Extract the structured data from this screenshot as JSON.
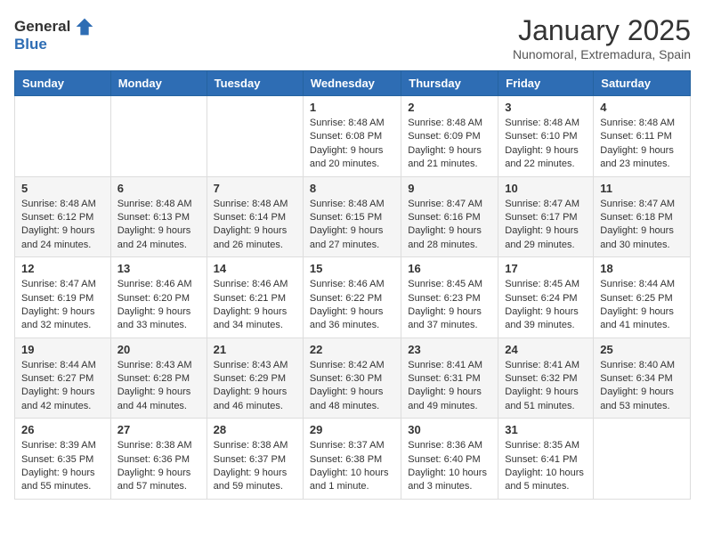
{
  "header": {
    "logo_general": "General",
    "logo_blue": "Blue",
    "title": "January 2025",
    "subtitle": "Nunomoral, Extremadura, Spain"
  },
  "weekdays": [
    "Sunday",
    "Monday",
    "Tuesday",
    "Wednesday",
    "Thursday",
    "Friday",
    "Saturday"
  ],
  "weeks": [
    [
      {
        "day": "",
        "sunrise": "",
        "sunset": "",
        "daylight": ""
      },
      {
        "day": "",
        "sunrise": "",
        "sunset": "",
        "daylight": ""
      },
      {
        "day": "",
        "sunrise": "",
        "sunset": "",
        "daylight": ""
      },
      {
        "day": "1",
        "sunrise": "Sunrise: 8:48 AM",
        "sunset": "Sunset: 6:08 PM",
        "daylight": "Daylight: 9 hours and 20 minutes."
      },
      {
        "day": "2",
        "sunrise": "Sunrise: 8:48 AM",
        "sunset": "Sunset: 6:09 PM",
        "daylight": "Daylight: 9 hours and 21 minutes."
      },
      {
        "day": "3",
        "sunrise": "Sunrise: 8:48 AM",
        "sunset": "Sunset: 6:10 PM",
        "daylight": "Daylight: 9 hours and 22 minutes."
      },
      {
        "day": "4",
        "sunrise": "Sunrise: 8:48 AM",
        "sunset": "Sunset: 6:11 PM",
        "daylight": "Daylight: 9 hours and 23 minutes."
      }
    ],
    [
      {
        "day": "5",
        "sunrise": "Sunrise: 8:48 AM",
        "sunset": "Sunset: 6:12 PM",
        "daylight": "Daylight: 9 hours and 24 minutes."
      },
      {
        "day": "6",
        "sunrise": "Sunrise: 8:48 AM",
        "sunset": "Sunset: 6:13 PM",
        "daylight": "Daylight: 9 hours and 24 minutes."
      },
      {
        "day": "7",
        "sunrise": "Sunrise: 8:48 AM",
        "sunset": "Sunset: 6:14 PM",
        "daylight": "Daylight: 9 hours and 26 minutes."
      },
      {
        "day": "8",
        "sunrise": "Sunrise: 8:48 AM",
        "sunset": "Sunset: 6:15 PM",
        "daylight": "Daylight: 9 hours and 27 minutes."
      },
      {
        "day": "9",
        "sunrise": "Sunrise: 8:47 AM",
        "sunset": "Sunset: 6:16 PM",
        "daylight": "Daylight: 9 hours and 28 minutes."
      },
      {
        "day": "10",
        "sunrise": "Sunrise: 8:47 AM",
        "sunset": "Sunset: 6:17 PM",
        "daylight": "Daylight: 9 hours and 29 minutes."
      },
      {
        "day": "11",
        "sunrise": "Sunrise: 8:47 AM",
        "sunset": "Sunset: 6:18 PM",
        "daylight": "Daylight: 9 hours and 30 minutes."
      }
    ],
    [
      {
        "day": "12",
        "sunrise": "Sunrise: 8:47 AM",
        "sunset": "Sunset: 6:19 PM",
        "daylight": "Daylight: 9 hours and 32 minutes."
      },
      {
        "day": "13",
        "sunrise": "Sunrise: 8:46 AM",
        "sunset": "Sunset: 6:20 PM",
        "daylight": "Daylight: 9 hours and 33 minutes."
      },
      {
        "day": "14",
        "sunrise": "Sunrise: 8:46 AM",
        "sunset": "Sunset: 6:21 PM",
        "daylight": "Daylight: 9 hours and 34 minutes."
      },
      {
        "day": "15",
        "sunrise": "Sunrise: 8:46 AM",
        "sunset": "Sunset: 6:22 PM",
        "daylight": "Daylight: 9 hours and 36 minutes."
      },
      {
        "day": "16",
        "sunrise": "Sunrise: 8:45 AM",
        "sunset": "Sunset: 6:23 PM",
        "daylight": "Daylight: 9 hours and 37 minutes."
      },
      {
        "day": "17",
        "sunrise": "Sunrise: 8:45 AM",
        "sunset": "Sunset: 6:24 PM",
        "daylight": "Daylight: 9 hours and 39 minutes."
      },
      {
        "day": "18",
        "sunrise": "Sunrise: 8:44 AM",
        "sunset": "Sunset: 6:25 PM",
        "daylight": "Daylight: 9 hours and 41 minutes."
      }
    ],
    [
      {
        "day": "19",
        "sunrise": "Sunrise: 8:44 AM",
        "sunset": "Sunset: 6:27 PM",
        "daylight": "Daylight: 9 hours and 42 minutes."
      },
      {
        "day": "20",
        "sunrise": "Sunrise: 8:43 AM",
        "sunset": "Sunset: 6:28 PM",
        "daylight": "Daylight: 9 hours and 44 minutes."
      },
      {
        "day": "21",
        "sunrise": "Sunrise: 8:43 AM",
        "sunset": "Sunset: 6:29 PM",
        "daylight": "Daylight: 9 hours and 46 minutes."
      },
      {
        "day": "22",
        "sunrise": "Sunrise: 8:42 AM",
        "sunset": "Sunset: 6:30 PM",
        "daylight": "Daylight: 9 hours and 48 minutes."
      },
      {
        "day": "23",
        "sunrise": "Sunrise: 8:41 AM",
        "sunset": "Sunset: 6:31 PM",
        "daylight": "Daylight: 9 hours and 49 minutes."
      },
      {
        "day": "24",
        "sunrise": "Sunrise: 8:41 AM",
        "sunset": "Sunset: 6:32 PM",
        "daylight": "Daylight: 9 hours and 51 minutes."
      },
      {
        "day": "25",
        "sunrise": "Sunrise: 8:40 AM",
        "sunset": "Sunset: 6:34 PM",
        "daylight": "Daylight: 9 hours and 53 minutes."
      }
    ],
    [
      {
        "day": "26",
        "sunrise": "Sunrise: 8:39 AM",
        "sunset": "Sunset: 6:35 PM",
        "daylight": "Daylight: 9 hours and 55 minutes."
      },
      {
        "day": "27",
        "sunrise": "Sunrise: 8:38 AM",
        "sunset": "Sunset: 6:36 PM",
        "daylight": "Daylight: 9 hours and 57 minutes."
      },
      {
        "day": "28",
        "sunrise": "Sunrise: 8:38 AM",
        "sunset": "Sunset: 6:37 PM",
        "daylight": "Daylight: 9 hours and 59 minutes."
      },
      {
        "day": "29",
        "sunrise": "Sunrise: 8:37 AM",
        "sunset": "Sunset: 6:38 PM",
        "daylight": "Daylight: 10 hours and 1 minute."
      },
      {
        "day": "30",
        "sunrise": "Sunrise: 8:36 AM",
        "sunset": "Sunset: 6:40 PM",
        "daylight": "Daylight: 10 hours and 3 minutes."
      },
      {
        "day": "31",
        "sunrise": "Sunrise: 8:35 AM",
        "sunset": "Sunset: 6:41 PM",
        "daylight": "Daylight: 10 hours and 5 minutes."
      },
      {
        "day": "",
        "sunrise": "",
        "sunset": "",
        "daylight": ""
      }
    ]
  ]
}
